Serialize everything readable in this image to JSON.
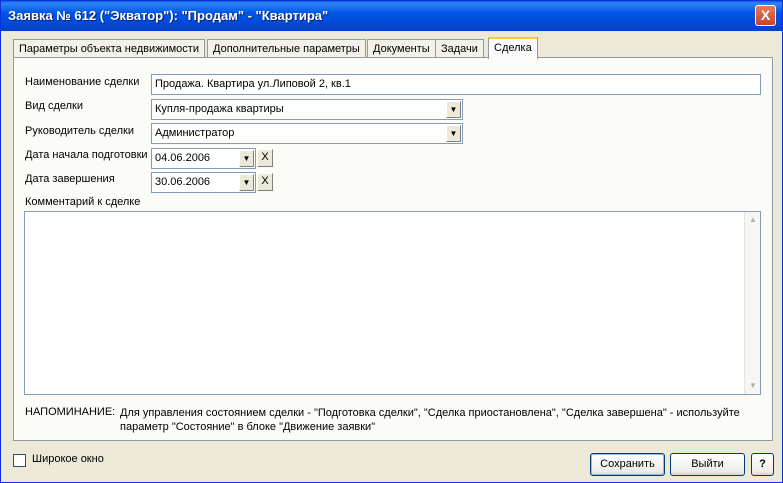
{
  "window": {
    "title": "Заявка № 612 (\"Экватор\"): \"Продам\" - \"Квартира\"",
    "close_label": "X"
  },
  "tabs": [
    {
      "label": "Параметры объекта недвижимости"
    },
    {
      "label": "Дополнительные параметры"
    },
    {
      "label": "Документы"
    },
    {
      "label": "Задачи"
    },
    {
      "label": "Сделка",
      "active": true
    }
  ],
  "form": {
    "deal_name": {
      "label": "Наименование сделки",
      "value": "Продажа. Квартира ул.Липовой 2, кв.1"
    },
    "deal_type": {
      "label": "Вид сделки",
      "value": "Купля-продажа квартиры"
    },
    "deal_manager": {
      "label": "Руководитель сделки",
      "value": "Администратор"
    },
    "start_date": {
      "label": "Дата начала подготовки",
      "value": "04.06.2006"
    },
    "end_date": {
      "label": "Дата завершения",
      "value": "30.06.2006"
    },
    "comment": {
      "label": "Комментарий к сделке",
      "value": ""
    },
    "clear_label": "X",
    "dropdown_glyph": "▼"
  },
  "note": {
    "label": "НАПОМИНАНИЕ:",
    "text": "Для управления состоянием сделки - \"Подготовка сделки\", \"Сделка приостановлена\", \"Сделка завершена\" - используйте параметр \"Состояние\" в блоке \"Движение заявки\""
  },
  "footer": {
    "wide_window_label": "Широкое окно",
    "wide_window_checked": false,
    "save_label": "Сохранить",
    "exit_label": "Выйти",
    "help_label": "?"
  }
}
